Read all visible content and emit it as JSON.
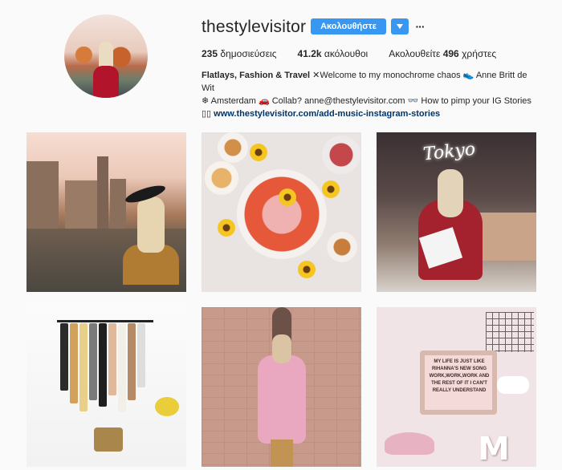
{
  "profile": {
    "username": "thestylevisitor",
    "follow_label": "Ακολουθήστε",
    "more_label": "···"
  },
  "stats": {
    "posts_count": "235",
    "posts_label": "δημοσιεύσεις",
    "followers_count": "41.2k",
    "followers_label": "ακόλουθοι",
    "following_prefix": "Ακολουθείτε",
    "following_count": "496",
    "following_suffix": "χρήστες"
  },
  "bio": {
    "name": "Flatlays, Fashion & Travel",
    "line1_rest": " ✕Welcome to my monochrome chaos 👟 Anne Britt de Wit",
    "line2": "❄ Amsterdam 🚗 Collab? anne@thestylevisitor.com 👓 How to pimp your IG Stories",
    "line3_prefix": "▯▯ ",
    "link": "www.thestylevisitor.com/add-music-instagram-stories"
  },
  "posts": {
    "neon_sign_text": "Tokyo",
    "letterboard_text": "MY LIFE IS JUST LIKE RIHANNA'S NEW SONG WORK,WORK,WORK AND THE REST OF IT I CAN'T REALLY UNDERSTAND",
    "letter_decor": "M"
  },
  "colors": {
    "accent": "#3897f0",
    "text": "#262626",
    "link": "#003569",
    "background": "#fafafa"
  },
  "icons": {
    "dropdown": "chevron-down-icon",
    "more": "more-icon"
  }
}
